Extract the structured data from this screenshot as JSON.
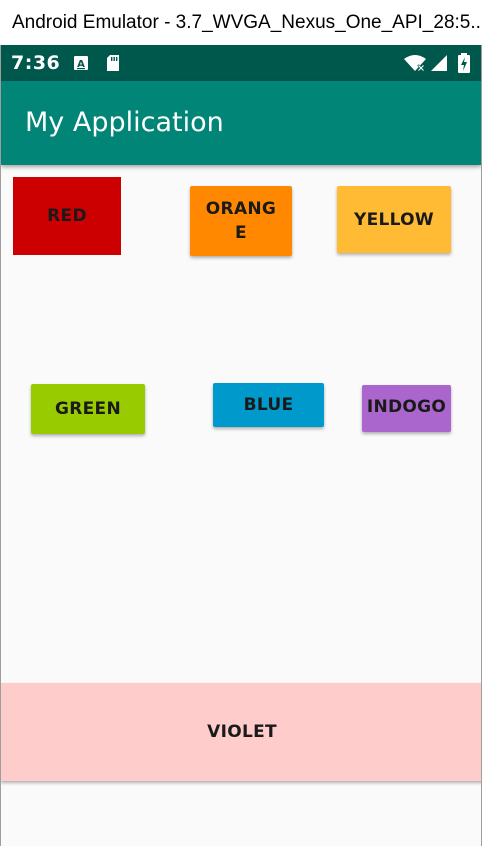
{
  "window": {
    "title": "Android Emulator - 3.7_WVGA_Nexus_One_API_28:5..."
  },
  "status_bar": {
    "time": "7:36",
    "icons": [
      "notification-a-icon",
      "sd-card-icon",
      "wifi-icon",
      "signal-icon",
      "battery-icon"
    ]
  },
  "app_bar": {
    "title": "My Application"
  },
  "colors": {
    "status_bar": "#00574b",
    "app_bar": "#008577",
    "background": "#fafafa"
  },
  "buttons": {
    "red": {
      "label": "RED",
      "color": "#cc0000"
    },
    "orange": {
      "label": "ORANGE",
      "color": "#ff8800"
    },
    "yellow": {
      "label": "YELLOW",
      "color": "#ffbb33"
    },
    "green": {
      "label": "GREEN",
      "color": "#99cc00"
    },
    "blue": {
      "label": "BLUE",
      "color": "#0099cc"
    },
    "indigo": {
      "label": "INDOGO",
      "color": "#aa66cc"
    },
    "violet": {
      "label": "VIOLET",
      "color": "#ffcccc"
    }
  }
}
